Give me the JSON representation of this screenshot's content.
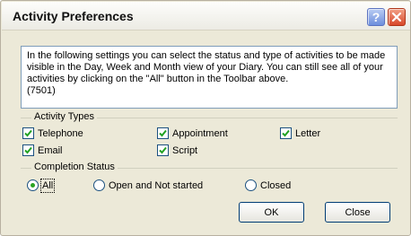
{
  "window": {
    "title": "Activity Preferences",
    "help_label": "?",
    "close_icon": "close-icon"
  },
  "info": {
    "text": "In the following settings you can select the status and type of activities to be made visible in the Day, Week and Month view of your Diary. You can still see all of your activities by clicking on the \"All\" button in the Toolbar above.",
    "code": "(7501)"
  },
  "activity_types": {
    "label": "Activity Types",
    "items": [
      {
        "label": "Telephone",
        "checked": true
      },
      {
        "label": "Appointment",
        "checked": true
      },
      {
        "label": "Letter",
        "checked": true
      },
      {
        "label": "Email",
        "checked": true
      },
      {
        "label": "Script",
        "checked": true
      }
    ]
  },
  "completion_status": {
    "label": "Completion Status",
    "options": [
      {
        "label": "All",
        "selected": true
      },
      {
        "label": "Open and Not started",
        "selected": false
      },
      {
        "label": "Closed",
        "selected": false
      }
    ]
  },
  "buttons": {
    "ok": "OK",
    "close": "Close"
  },
  "colors": {
    "check": "#21a121",
    "radio_dot": "#2aa322",
    "dialog_bg": "#ece9d8"
  }
}
